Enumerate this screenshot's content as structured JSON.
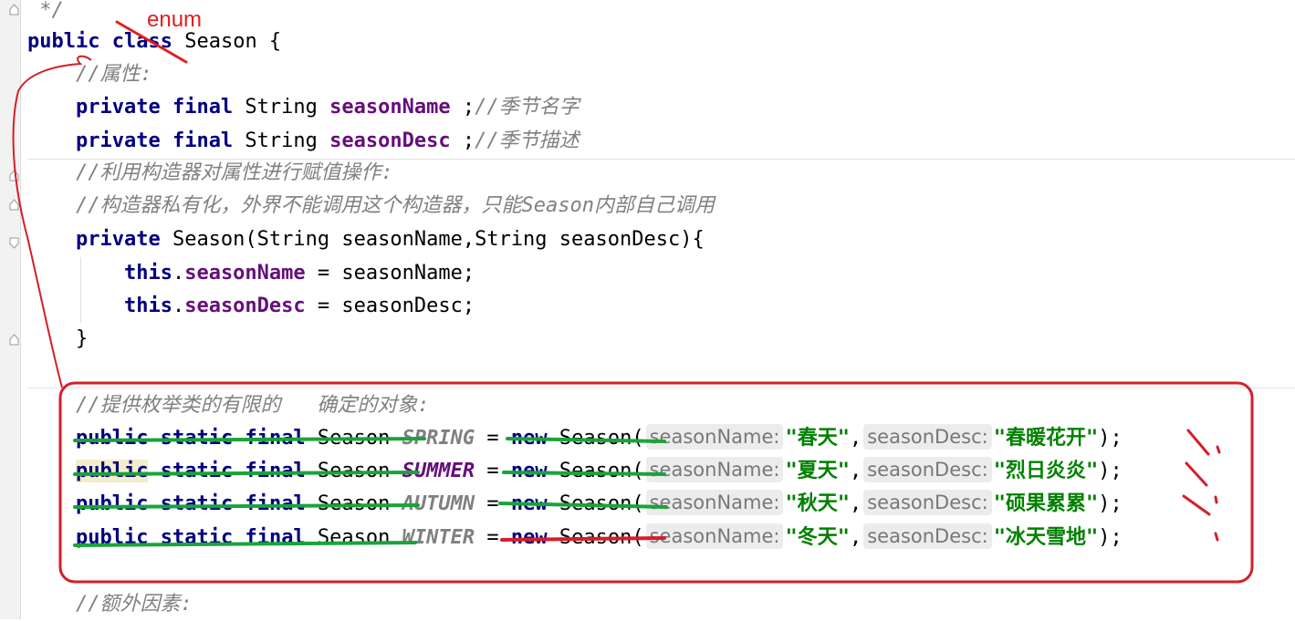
{
  "editor": {
    "lines": [
      {
        "id": "doc-end",
        "tokens": [
          {
            "t": " */",
            "c": "cmt"
          }
        ]
      },
      {
        "id": "class-decl",
        "tokens": [
          {
            "t": "public",
            "c": "kw"
          },
          {
            "t": " "
          },
          {
            "t": "class",
            "c": "kw"
          },
          {
            "t": " Season {"
          }
        ]
      },
      {
        "id": "cmt-attrs",
        "tokens": [
          {
            "t": "    "
          },
          {
            "t": "//属性:",
            "c": "cmt"
          }
        ]
      },
      {
        "id": "field-name",
        "tokens": [
          {
            "t": "    "
          },
          {
            "t": "private",
            "c": "kw"
          },
          {
            "t": " "
          },
          {
            "t": "final",
            "c": "kw"
          },
          {
            "t": " String "
          },
          {
            "t": "seasonName",
            "c": "fld"
          },
          {
            "t": " ;"
          },
          {
            "t": "//季节名字",
            "c": "cmt"
          }
        ]
      },
      {
        "id": "field-desc",
        "tokens": [
          {
            "t": "    "
          },
          {
            "t": "private",
            "c": "kw"
          },
          {
            "t": " "
          },
          {
            "t": "final",
            "c": "kw"
          },
          {
            "t": " String "
          },
          {
            "t": "seasonDesc",
            "c": "fld"
          },
          {
            "t": " ;"
          },
          {
            "t": "//季节描述",
            "c": "cmt"
          }
        ]
      },
      {
        "id": "cmt-ctor-1",
        "tokens": [
          {
            "t": "    "
          },
          {
            "t": "//利用构造器对属性进行赋值操作:",
            "c": "cmt"
          }
        ]
      },
      {
        "id": "cmt-ctor-2",
        "tokens": [
          {
            "t": "    "
          },
          {
            "t": "//构造器私有化，外界不能调用这个构造器，只能Season内部自己调用",
            "c": "cmt"
          }
        ]
      },
      {
        "id": "ctor-decl",
        "tokens": [
          {
            "t": "    "
          },
          {
            "t": "private",
            "c": "kw"
          },
          {
            "t": " Season(String seasonName,String seasonDesc){"
          }
        ]
      },
      {
        "id": "ctor-assign-name",
        "tokens": [
          {
            "t": "        "
          },
          {
            "t": "this",
            "c": "kw"
          },
          {
            "t": "."
          },
          {
            "t": "seasonName",
            "c": "fld"
          },
          {
            "t": " = seasonName;"
          }
        ]
      },
      {
        "id": "ctor-assign-desc",
        "tokens": [
          {
            "t": "        "
          },
          {
            "t": "this",
            "c": "kw"
          },
          {
            "t": "."
          },
          {
            "t": "seasonDesc",
            "c": "fld"
          },
          {
            "t": " = seasonDesc;"
          }
        ]
      },
      {
        "id": "ctor-close",
        "tokens": [
          {
            "t": "    }"
          }
        ]
      },
      {
        "id": "blank",
        "tokens": [
          {
            "t": ""
          }
        ]
      },
      {
        "id": "cmt-objects",
        "tokens": [
          {
            "t": "    "
          },
          {
            "t": "//提供枚举类的有限的   确定的对象:",
            "c": "cmt"
          }
        ]
      },
      {
        "id": "const-spring",
        "tokens": [
          {
            "t": "    "
          },
          {
            "t": "public",
            "c": "kw"
          },
          {
            "t": " "
          },
          {
            "t": "static",
            "c": "kw"
          },
          {
            "t": " "
          },
          {
            "t": "final",
            "c": "kw"
          },
          {
            "t": " Season "
          },
          {
            "t": "SPRING",
            "c": "fsg"
          },
          {
            "t": " = "
          },
          {
            "t": "new",
            "c": "kw"
          },
          {
            "t": " Season("
          },
          {
            "t": "seasonName:",
            "c": "hint"
          },
          {
            "t": "\"春天\"",
            "c": "str"
          },
          {
            "t": ","
          },
          {
            "t": "seasonDesc:",
            "c": "hint"
          },
          {
            "t": "\"春暖花开\"",
            "c": "str"
          },
          {
            "t": ");"
          }
        ]
      },
      {
        "id": "const-summer",
        "tokens": [
          {
            "t": "    "
          },
          {
            "t": "public",
            "c": "kw hl"
          },
          {
            "t": " "
          },
          {
            "t": "static",
            "c": "kw"
          },
          {
            "t": " "
          },
          {
            "t": "final",
            "c": "kw"
          },
          {
            "t": " Season "
          },
          {
            "t": "SUMMER",
            "c": "fst"
          },
          {
            "t": " = "
          },
          {
            "t": "new",
            "c": "kw"
          },
          {
            "t": " Season("
          },
          {
            "t": "seasonName:",
            "c": "hint"
          },
          {
            "t": "\"夏天\"",
            "c": "str"
          },
          {
            "t": ","
          },
          {
            "t": "seasonDesc:",
            "c": "hint"
          },
          {
            "t": "\"烈日炎炎\"",
            "c": "str"
          },
          {
            "t": ");"
          }
        ]
      },
      {
        "id": "const-autumn",
        "tokens": [
          {
            "t": "    "
          },
          {
            "t": "public",
            "c": "kw"
          },
          {
            "t": " "
          },
          {
            "t": "static",
            "c": "kw"
          },
          {
            "t": " "
          },
          {
            "t": "final",
            "c": "kw"
          },
          {
            "t": " Season "
          },
          {
            "t": "AUTUMN",
            "c": "fsg"
          },
          {
            "t": " = "
          },
          {
            "t": "new",
            "c": "kw"
          },
          {
            "t": " Season("
          },
          {
            "t": "seasonName:",
            "c": "hint"
          },
          {
            "t": "\"秋天\"",
            "c": "str"
          },
          {
            "t": ","
          },
          {
            "t": "seasonDesc:",
            "c": "hint"
          },
          {
            "t": "\"硕果累累\"",
            "c": "str"
          },
          {
            "t": ");"
          }
        ]
      },
      {
        "id": "const-winter",
        "tokens": [
          {
            "t": "    "
          },
          {
            "t": "public",
            "c": "kw"
          },
          {
            "t": " "
          },
          {
            "t": "static",
            "c": "kw"
          },
          {
            "t": " "
          },
          {
            "t": "final",
            "c": "kw"
          },
          {
            "t": " Season "
          },
          {
            "t": "WINTER",
            "c": "fsg"
          },
          {
            "t": " = "
          },
          {
            "t": "new",
            "c": "kw"
          },
          {
            "t": " Season("
          },
          {
            "t": "seasonName:",
            "c": "hint"
          },
          {
            "t": "\"冬天\"",
            "c": "str"
          },
          {
            "t": ","
          },
          {
            "t": "seasonDesc:",
            "c": "hint"
          },
          {
            "t": "\"冰天雪地\"",
            "c": "str"
          },
          {
            "t": ");"
          }
        ]
      },
      {
        "id": "blank-2",
        "tokens": [
          {
            "t": ""
          }
        ]
      },
      {
        "id": "cmt-extra",
        "tokens": [
          {
            "t": "    "
          },
          {
            "t": "//额外因素:",
            "c": "cmt"
          }
        ]
      }
    ]
  },
  "annotations": {
    "handwritten_note": "enum",
    "note_color": "#e02020",
    "strike_color": "#1aa33a",
    "box_color": "#d41f2a"
  }
}
